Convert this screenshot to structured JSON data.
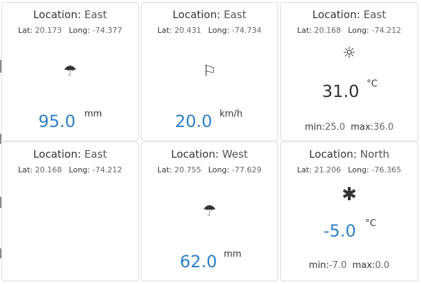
{
  "cards": [
    {
      "location_label": "Location:",
      "location": "East",
      "lat_label": "Lat:",
      "lat": "20.173",
      "long_label": "Long:",
      "long": "-74.377",
      "icon": "umbrella-icon",
      "icon_glyph": "☂",
      "value": "95.0",
      "unit": "mm"
    },
    {
      "location_label": "Location:",
      "location": "East",
      "lat_label": "Lat:",
      "lat": "20.431",
      "long_label": "Long:",
      "long": "-74.734",
      "icon": "flag-icon",
      "icon_glyph": "⚐",
      "value": "20.0",
      "unit": "km/h"
    },
    {
      "location_label": "Location:",
      "location": "East",
      "lat_label": "Lat:",
      "lat": "20.168",
      "long_label": "Long:",
      "long": "-74.212",
      "icon": "sun-icon",
      "icon_glyph": "☼",
      "value": "31.0",
      "unit": "°C",
      "min_label": "min:",
      "min": "25.0",
      "max_label": "max:",
      "max": "36.0"
    },
    {
      "location_label": "Location:",
      "location": "East",
      "lat_label": "Lat:",
      "lat": "20.168",
      "long_label": "Long:",
      "long": "-74.212"
    },
    {
      "location_label": "Location:",
      "location": "West",
      "lat_label": "Lat:",
      "lat": "20.755",
      "long_label": "Long:",
      "long": "-77.629",
      "icon": "umbrella-icon",
      "icon_glyph": "☂",
      "value": "62.0",
      "unit": "mm"
    },
    {
      "location_label": "Location:",
      "location": "North",
      "lat_label": "Lat:",
      "lat": "21.206",
      "long_label": "Long:",
      "long": "-76.365",
      "icon": "snowflake-icon",
      "icon_glyph": "✱",
      "value": "-5.0",
      "unit": "°C",
      "min_label": "min:",
      "min": "-7.0",
      "max_label": "max:",
      "max": "0.0"
    }
  ],
  "colors": {
    "value_blue": "#2f80c9",
    "value_dark": "#333333",
    "border": "#dcdcdc"
  }
}
